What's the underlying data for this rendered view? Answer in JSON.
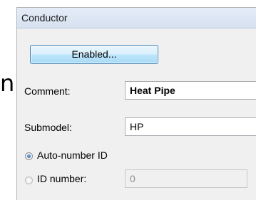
{
  "side_glyph": "n",
  "panel": {
    "title": "Conductor",
    "enabled_button": "Enabled...",
    "comment": {
      "label": "Comment:",
      "value": "Heat Pipe"
    },
    "submodel": {
      "label": "Submodel:",
      "value": "HP"
    },
    "auto_number": {
      "label": "Auto-number ID",
      "selected": true
    },
    "id_number": {
      "label": "ID number:",
      "value": "0",
      "selected": false
    }
  }
}
